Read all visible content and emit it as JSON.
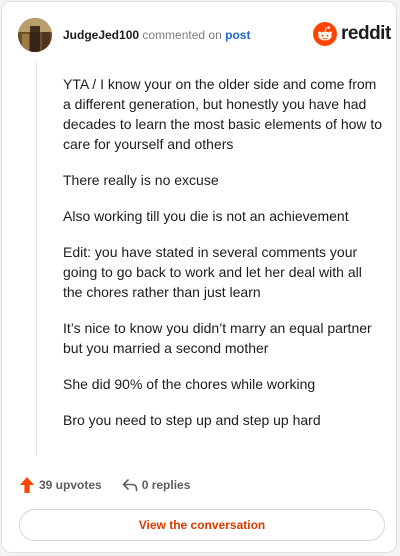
{
  "header": {
    "username": "JudgeJed100",
    "action_text": "commented on",
    "post_link": "post",
    "logo_text": "reddit"
  },
  "comment": {
    "paragraphs": [
      "YTA / I know your on the older side and come from a different generation, but honestly you have had decades to learn the most basic elements of how to care for yourself and others",
      "There really is no excuse",
      "Also working till you die is not an achievement",
      "Edit: you have stated in several comments your going to go back to work and let her deal with all the chores rather than just learn",
      "It’s nice to know you didn’t marry an equal partner but you married a second mother",
      "She did 90% of the chores while working",
      "Bro you need to step up and step up hard"
    ]
  },
  "footer": {
    "upvotes_label": "39 upvotes",
    "replies_label": "0 replies",
    "view_button_label": "View the conversation"
  },
  "icons": {
    "logo": "reddit-snoo-icon",
    "upvote": "upvote-arrow-icon",
    "reply": "reply-arrow-icon"
  },
  "colors": {
    "brand": "#ff4500",
    "link": "#1f68c3",
    "button_text": "#d93a00"
  }
}
